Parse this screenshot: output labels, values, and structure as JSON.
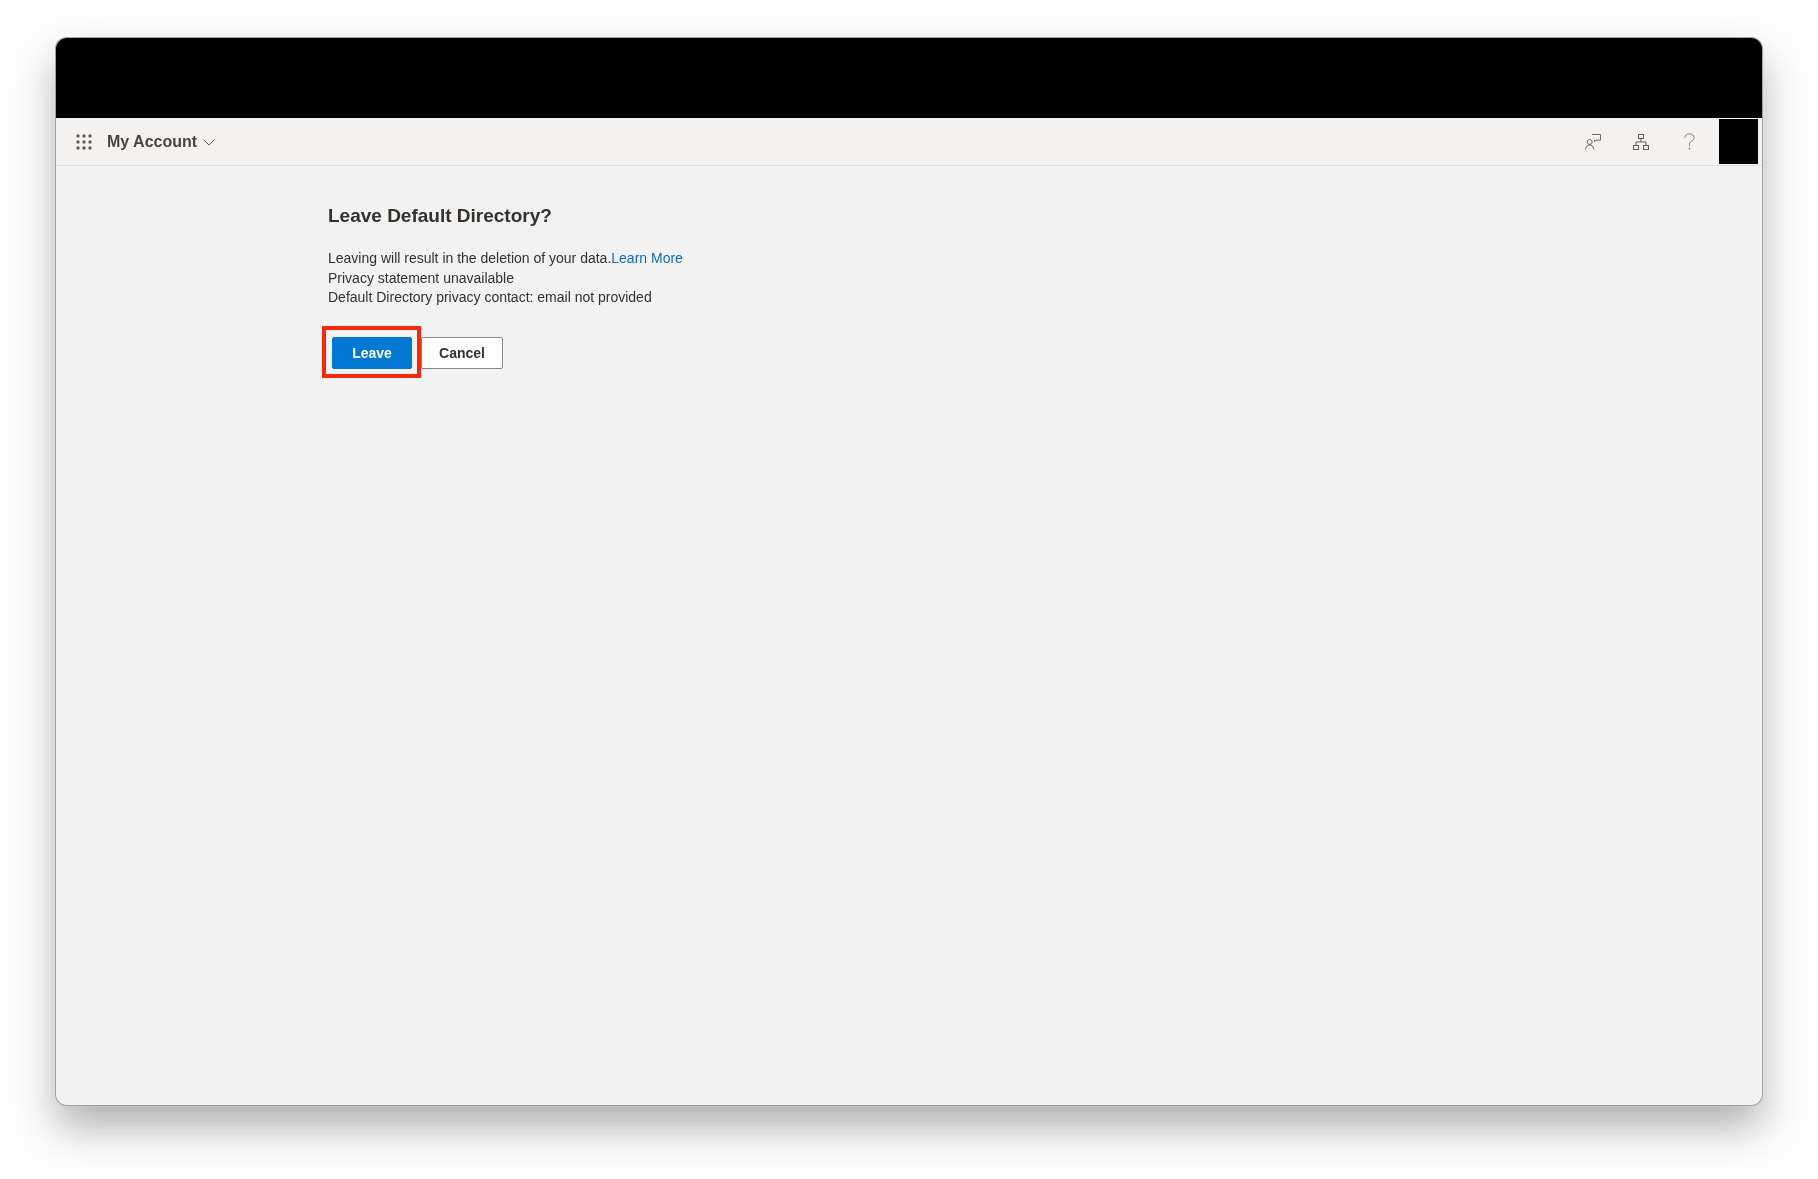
{
  "nav": {
    "title": "My Account"
  },
  "dialog": {
    "title": "Leave Default Directory?",
    "message": {
      "text": "Leaving will result in the deletion of your data.",
      "link": "Learn More"
    },
    "details": [
      "Privacy statement unavailable",
      "Default Directory privacy contact: email not provided"
    ],
    "buttons": [
      {
        "label": "Leave",
        "kind": "primary",
        "highlighted": true
      },
      {
        "label": "Cancel",
        "kind": "secondary",
        "highlighted": false
      }
    ]
  }
}
